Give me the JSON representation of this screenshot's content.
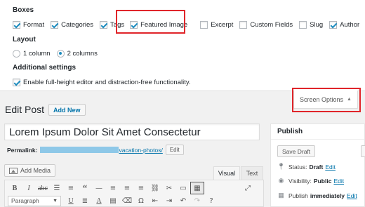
{
  "screen_options": {
    "boxes_title": "Boxes",
    "boxes": [
      {
        "label": "Format",
        "checked": true
      },
      {
        "label": "Categories",
        "checked": true
      },
      {
        "label": "Tags",
        "checked": true
      },
      {
        "label": "Featured Image",
        "checked": true
      },
      {
        "label": "Excerpt",
        "checked": false
      },
      {
        "label": "Custom Fields",
        "checked": false
      },
      {
        "label": "Slug",
        "checked": false
      },
      {
        "label": "Author",
        "checked": true
      }
    ],
    "layout_title": "Layout",
    "layout_options": [
      {
        "label": "1 column",
        "checked": false
      },
      {
        "label": "2 columns",
        "checked": true
      }
    ],
    "additional_title": "Additional settings",
    "fullheight_label": "Enable full-height editor and distraction-free functionality.",
    "fullheight_checked": true,
    "tab_label": "Screen Options",
    "highlight_color": "#e0252a"
  },
  "header": {
    "title": "Edit Post",
    "add_new": "Add New"
  },
  "post": {
    "title": "Lorem Ipsum Dolor Sit Amet Consectetur",
    "permalink_label": "Permalink:",
    "permalink_slug": "vacation-photos/",
    "edit_label": "Edit"
  },
  "editor": {
    "add_media": "Add Media",
    "tab_visual": "Visual",
    "tab_text": "Text",
    "format_select": "Paragraph"
  },
  "publish": {
    "title": "Publish",
    "save_draft": "Save Draft",
    "status_label": "Status:",
    "status_value": "Draft",
    "visibility_label": "Visibility:",
    "visibility_value": "Public",
    "publish_label": "Publish",
    "publish_value": "immediately",
    "edit_link": "Edit"
  },
  "colors": {
    "link": "#0073aa",
    "checkbox_check": "#1e8cbe",
    "background": "#f1f1f1"
  }
}
